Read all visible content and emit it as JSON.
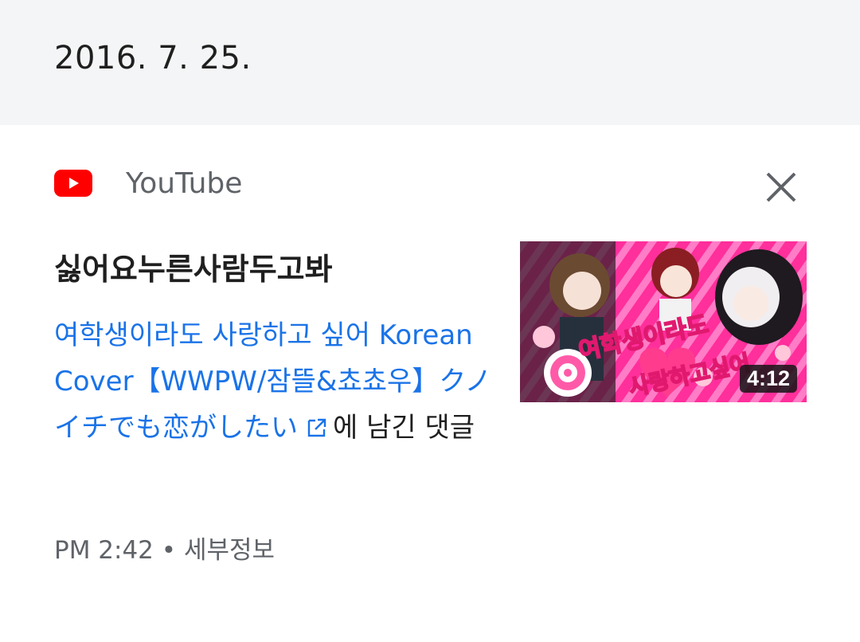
{
  "date_header": "2016. 7. 25.",
  "source": {
    "name": "YouTube",
    "icon": "youtube-logo-icon",
    "brand_color": "#ff0000"
  },
  "close_icon": "close-icon",
  "comment_title": "싫어요누른사람두고봐",
  "video_link": "여학생이라도 사랑하고 싶어 Korean Cover【WWPW/잠뜰&쵸쵸우】クノイチでも恋がしたい",
  "suffix": "에 남긴 댓글",
  "time": "PM 2:42",
  "separator": "•",
  "details_label": "세부정보",
  "thumbnail": {
    "overlay_text_line1": "여학생이라도",
    "overlay_text_line2": "사랑하고싶어",
    "duration": "4:12"
  },
  "colors": {
    "link": "#1a73e8",
    "header_bg": "#f4f5f6",
    "text": "#1f1f1f",
    "muted": "#5f6368"
  }
}
